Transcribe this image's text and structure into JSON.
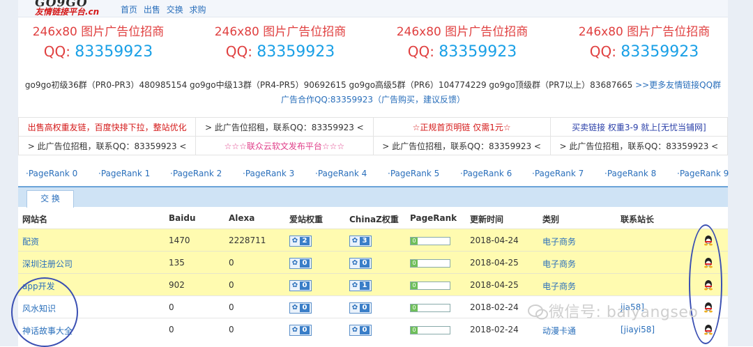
{
  "logo": {
    "brand": "GO9GO",
    "sub": "友情链接平台.cn"
  },
  "nav": [
    "首页",
    "出售",
    "交换",
    "求购"
  ],
  "ads": [
    {
      "title": "246x80 图片广告位招商",
      "qq_label": "QQ:",
      "qq": "83359923"
    },
    {
      "title": "246x80 图片广告位招商",
      "qq_label": "QQ:",
      "qq": "83359923"
    },
    {
      "title": "246x80 图片广告位招商",
      "qq_label": "QQ:",
      "qq": "83359923"
    },
    {
      "title": "246x80 图片广告位招商",
      "qq_label": "QQ:",
      "qq": "83359923"
    }
  ],
  "groups_text": "go9go初级36群（PR0-PR3）480985154 go9go中级13群（PR4-PR5）90692615 go9go高级5群（PR6）104774229 go9go顶级群（PR7以上）83687665 ",
  "groups_more": ">>更多友情链接QQ群",
  "coop_text": "广告合作QQ:83359923（广告购买，建议反馈）",
  "link_grid": [
    [
      "出售高权重友链，百度快排下拉，整站优化",
      "> 此广告位招租，联系QQ：83359923 <",
      "☆正规首页明链 仅需1元☆",
      "买卖链接 权重3-9 就上[无忧当铺网]"
    ],
    [
      "> 此广告位招租，联系QQ：83359923 <",
      "☆☆☆联众云软文发布平台☆☆☆",
      "> 此广告位招租，联系QQ：83359923 <",
      "> 此广告位招租，联系QQ：83359923 <"
    ]
  ],
  "pagerank_links": [
    "·PageRank 0",
    "·PageRank 1",
    "·PageRank 2",
    "·PageRank 3",
    "·PageRank 4",
    "·PageRank 5",
    "·PageRank 6",
    "·PageRank 7",
    "·PageRank 8",
    "·PageRank 9"
  ],
  "tab_label": "交 换",
  "table": {
    "headers": [
      "网站名",
      "Baidu",
      "Alexa",
      "爱站权重",
      "ChinaZ权重",
      "PageRank",
      "更新时间",
      "类别",
      "联系站长"
    ],
    "rows": [
      {
        "site": "配资",
        "baidu": "1470",
        "alexa": "2228711",
        "aizhan": "2",
        "chinaz": "3",
        "pr": "0",
        "date": "2018-04-24",
        "category": "电子商务",
        "contact": ""
      },
      {
        "site": "深圳注册公司",
        "baidu": "135",
        "alexa": "0",
        "aizhan": "0",
        "chinaz": "0",
        "pr": "0",
        "date": "2018-04-25",
        "category": "电子商务",
        "contact": ""
      },
      {
        "site": "app开发",
        "baidu": "902",
        "alexa": "0",
        "aizhan": "0",
        "chinaz": "1",
        "pr": "0",
        "date": "2018-04-25",
        "category": "电子商务",
        "contact": ""
      },
      {
        "site": "风水知识",
        "baidu": "0",
        "alexa": "0",
        "aizhan": "0",
        "chinaz": "0",
        "pr": "0",
        "date": "2018-02-24",
        "category": "",
        "contact": "jia58]"
      },
      {
        "site": "神话故事大全",
        "baidu": "0",
        "alexa": "0",
        "aizhan": "0",
        "chinaz": "0",
        "pr": "0",
        "date": "2018-02-24",
        "category": "动漫卡通",
        "contact": "[jiayi58]"
      }
    ]
  },
  "watermark": "微信号: baiyangseo",
  "colors": {
    "ad_red": "#e04040",
    "qq_blue": "#1aa0e6",
    "link_blue": "#2a6fbb",
    "row_yellow": "#fffbb0",
    "annot_circle": "#3a4fb2"
  }
}
